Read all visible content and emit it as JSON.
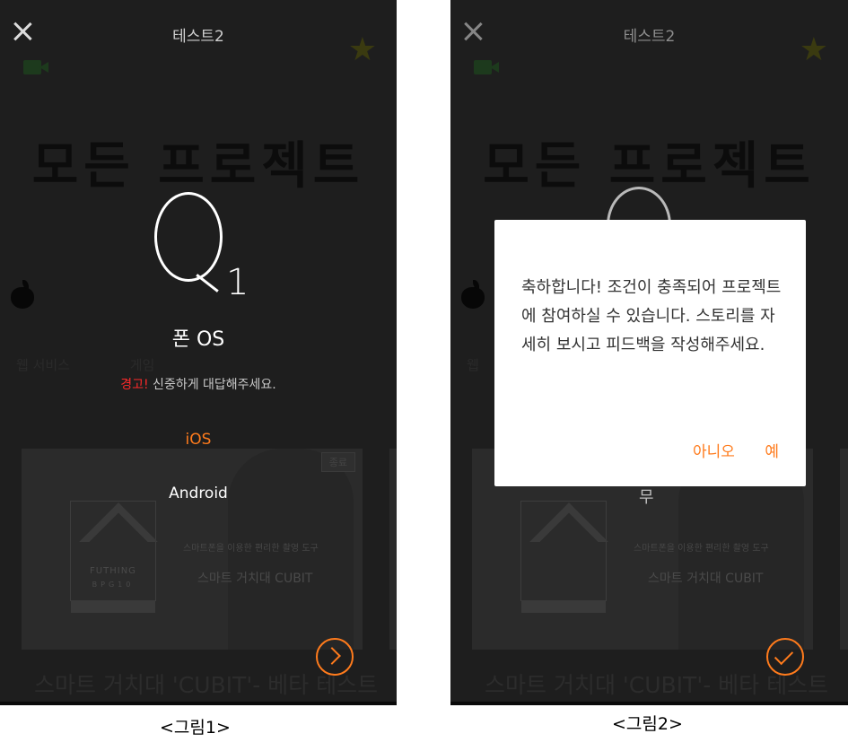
{
  "figure1": {
    "title": "테스트2",
    "bg_title": "모든 프로젝트",
    "categories": [
      "웹 서비스",
      "게임"
    ],
    "card_badge": "종료",
    "card_logo_text": "FUTHING",
    "card_logo_sub": "BPG10",
    "card_tagline": "스마트폰을 이용한 편리한 촬영 도구",
    "card_product": "스마트 거치대 CUBIT",
    "bottom_title": "스마트 거치대 'CUBIT'- 베타 테스트",
    "question_mark": "Q",
    "question_number": "1",
    "question_text": "폰 OS",
    "warning_label": "경고!",
    "warning_text": " 신중하게 대답해주세요.",
    "options": [
      {
        "label": "iOS",
        "selected": true
      },
      {
        "label": "Android",
        "selected": false
      }
    ],
    "next_icon": "chevron-right-icon",
    "caption": "<그림1>"
  },
  "figure2": {
    "title": "테스트2",
    "bg_title": "모든 프로젝트",
    "categories": [
      "웹"
    ],
    "peek_text": "무",
    "card_tagline": "스마트폰을 이용한 편리한 촬영 도구",
    "card_product": "스마트 거치대 CUBIT",
    "bottom_title": "스마트 거치대 'CUBIT'- 베타 테스트",
    "dialog": {
      "message": "축하합니다! 조건이 충족되어 프로젝트에 참여하실 수 있습니다. 스토리를 자세히 보시고 피드백을 작성해주세요.",
      "no_label": "아니오",
      "yes_label": "예"
    },
    "confirm_icon": "check-icon",
    "caption": "<그림2>"
  },
  "colors": {
    "accent": "#ff7b1c",
    "warning": "#ff2a2a",
    "overlay": "#1e1e1e",
    "dialog_bg": "#ffffff"
  }
}
